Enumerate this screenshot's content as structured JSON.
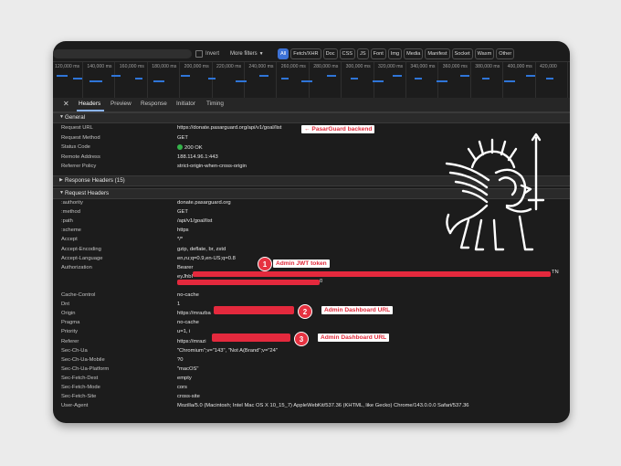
{
  "filter": {
    "invert_label": "Invert",
    "more_filters_label": "More filters",
    "chips": [
      "All",
      "Fetch/XHR",
      "Doc",
      "CSS",
      "JS",
      "Font",
      "Img",
      "Media",
      "Manifest",
      "Socket",
      "Wasm",
      "Other"
    ],
    "active_chip": "All"
  },
  "timeline": {
    "ticks": [
      "120,000 ms",
      "140,000 ms",
      "160,000 ms",
      "180,000 ms",
      "200,000 ms",
      "220,000 ms",
      "240,000 ms",
      "260,000 ms",
      "280,000 ms",
      "300,000 ms",
      "320,000 ms",
      "340,000 ms",
      "360,000 ms",
      "380,000 ms",
      "400,000 ms",
      "420,000"
    ]
  },
  "tabs": [
    "Headers",
    "Preview",
    "Response",
    "Initiator",
    "Timing"
  ],
  "general": {
    "title": "General",
    "rows": [
      {
        "key": "Request URL",
        "value": "https://donate.pasarguard.org/api/v1/goal/list"
      },
      {
        "key": "Request Method",
        "value": "GET"
      },
      {
        "key": "Status Code",
        "value": "200 OK"
      },
      {
        "key": "Remote Address",
        "value": "188.114.96.1:443"
      },
      {
        "key": "Referrer Policy",
        "value": "strict-origin-when-cross-origin"
      }
    ]
  },
  "response_headers": {
    "title": "Response Headers (15)"
  },
  "request_headers": {
    "title": "Request Headers",
    "rows": [
      {
        "key": ":authority",
        "value": "donate.pasarguard.org"
      },
      {
        "key": ":method",
        "value": "GET"
      },
      {
        "key": ":path",
        "value": "/api/v1/goal/list"
      },
      {
        "key": ":scheme",
        "value": "https"
      },
      {
        "key": "Accept",
        "value": "*/*"
      },
      {
        "key": "Accept-Encoding",
        "value": "gzip, deflate, br, zstd"
      },
      {
        "key": "Accept-Language",
        "value": "en,ru;q=0.9,en-US;q=0.8"
      },
      {
        "key": "Authorization",
        "value": "Bearer"
      },
      {
        "key": "",
        "value": "eyJhbI"
      },
      {
        "key": "",
        "value": ""
      },
      {
        "key": "Cache-Control",
        "value": "no-cache"
      },
      {
        "key": "Dnt",
        "value": "1"
      },
      {
        "key": "Origin",
        "value": "https://mrazba"
      },
      {
        "key": "Pragma",
        "value": "no-cache"
      },
      {
        "key": "Priority",
        "value": "u=1, i"
      },
      {
        "key": "Referer",
        "value": "https://mrazi"
      },
      {
        "key": "Sec-Ch-Ua",
        "value": "\"Chromium\";v=\"143\", \"Not A(Brand\";v=\"24\""
      },
      {
        "key": "Sec-Ch-Ua-Mobile",
        "value": "?0"
      },
      {
        "key": "Sec-Ch-Ua-Platform",
        "value": "\"macOS\""
      },
      {
        "key": "Sec-Fetch-Dest",
        "value": "empty"
      },
      {
        "key": "Sec-Fetch-Mode",
        "value": "cors"
      },
      {
        "key": "Sec-Fetch-Site",
        "value": "cross-site"
      },
      {
        "key": "User-Agent",
        "value": "Mozilla/5.0 (Macintosh; Intel Mac OS X 10_15_7) AppleWebKit/537.36 (KHTML, like Gecko) Chrome/143.0.0.0 Safari/537.36"
      }
    ],
    "token_tail_1": "TN",
    "token_tail_2": "0"
  },
  "annotations": {
    "backend": "← PasarGuard backend",
    "badge1": "1",
    "badge2": "2",
    "badge3": "3",
    "jwt": "Admin JWT token",
    "dash1": "Admin Dashboard URL",
    "dash2": "Admin Dashboard URL"
  },
  "colors": {
    "accent": "#3d72d6",
    "redaction": "#e4293d",
    "status_ok": "#35b34a"
  },
  "icons": {
    "close": "close-icon",
    "logo": "winged-lion-sword-logo"
  }
}
